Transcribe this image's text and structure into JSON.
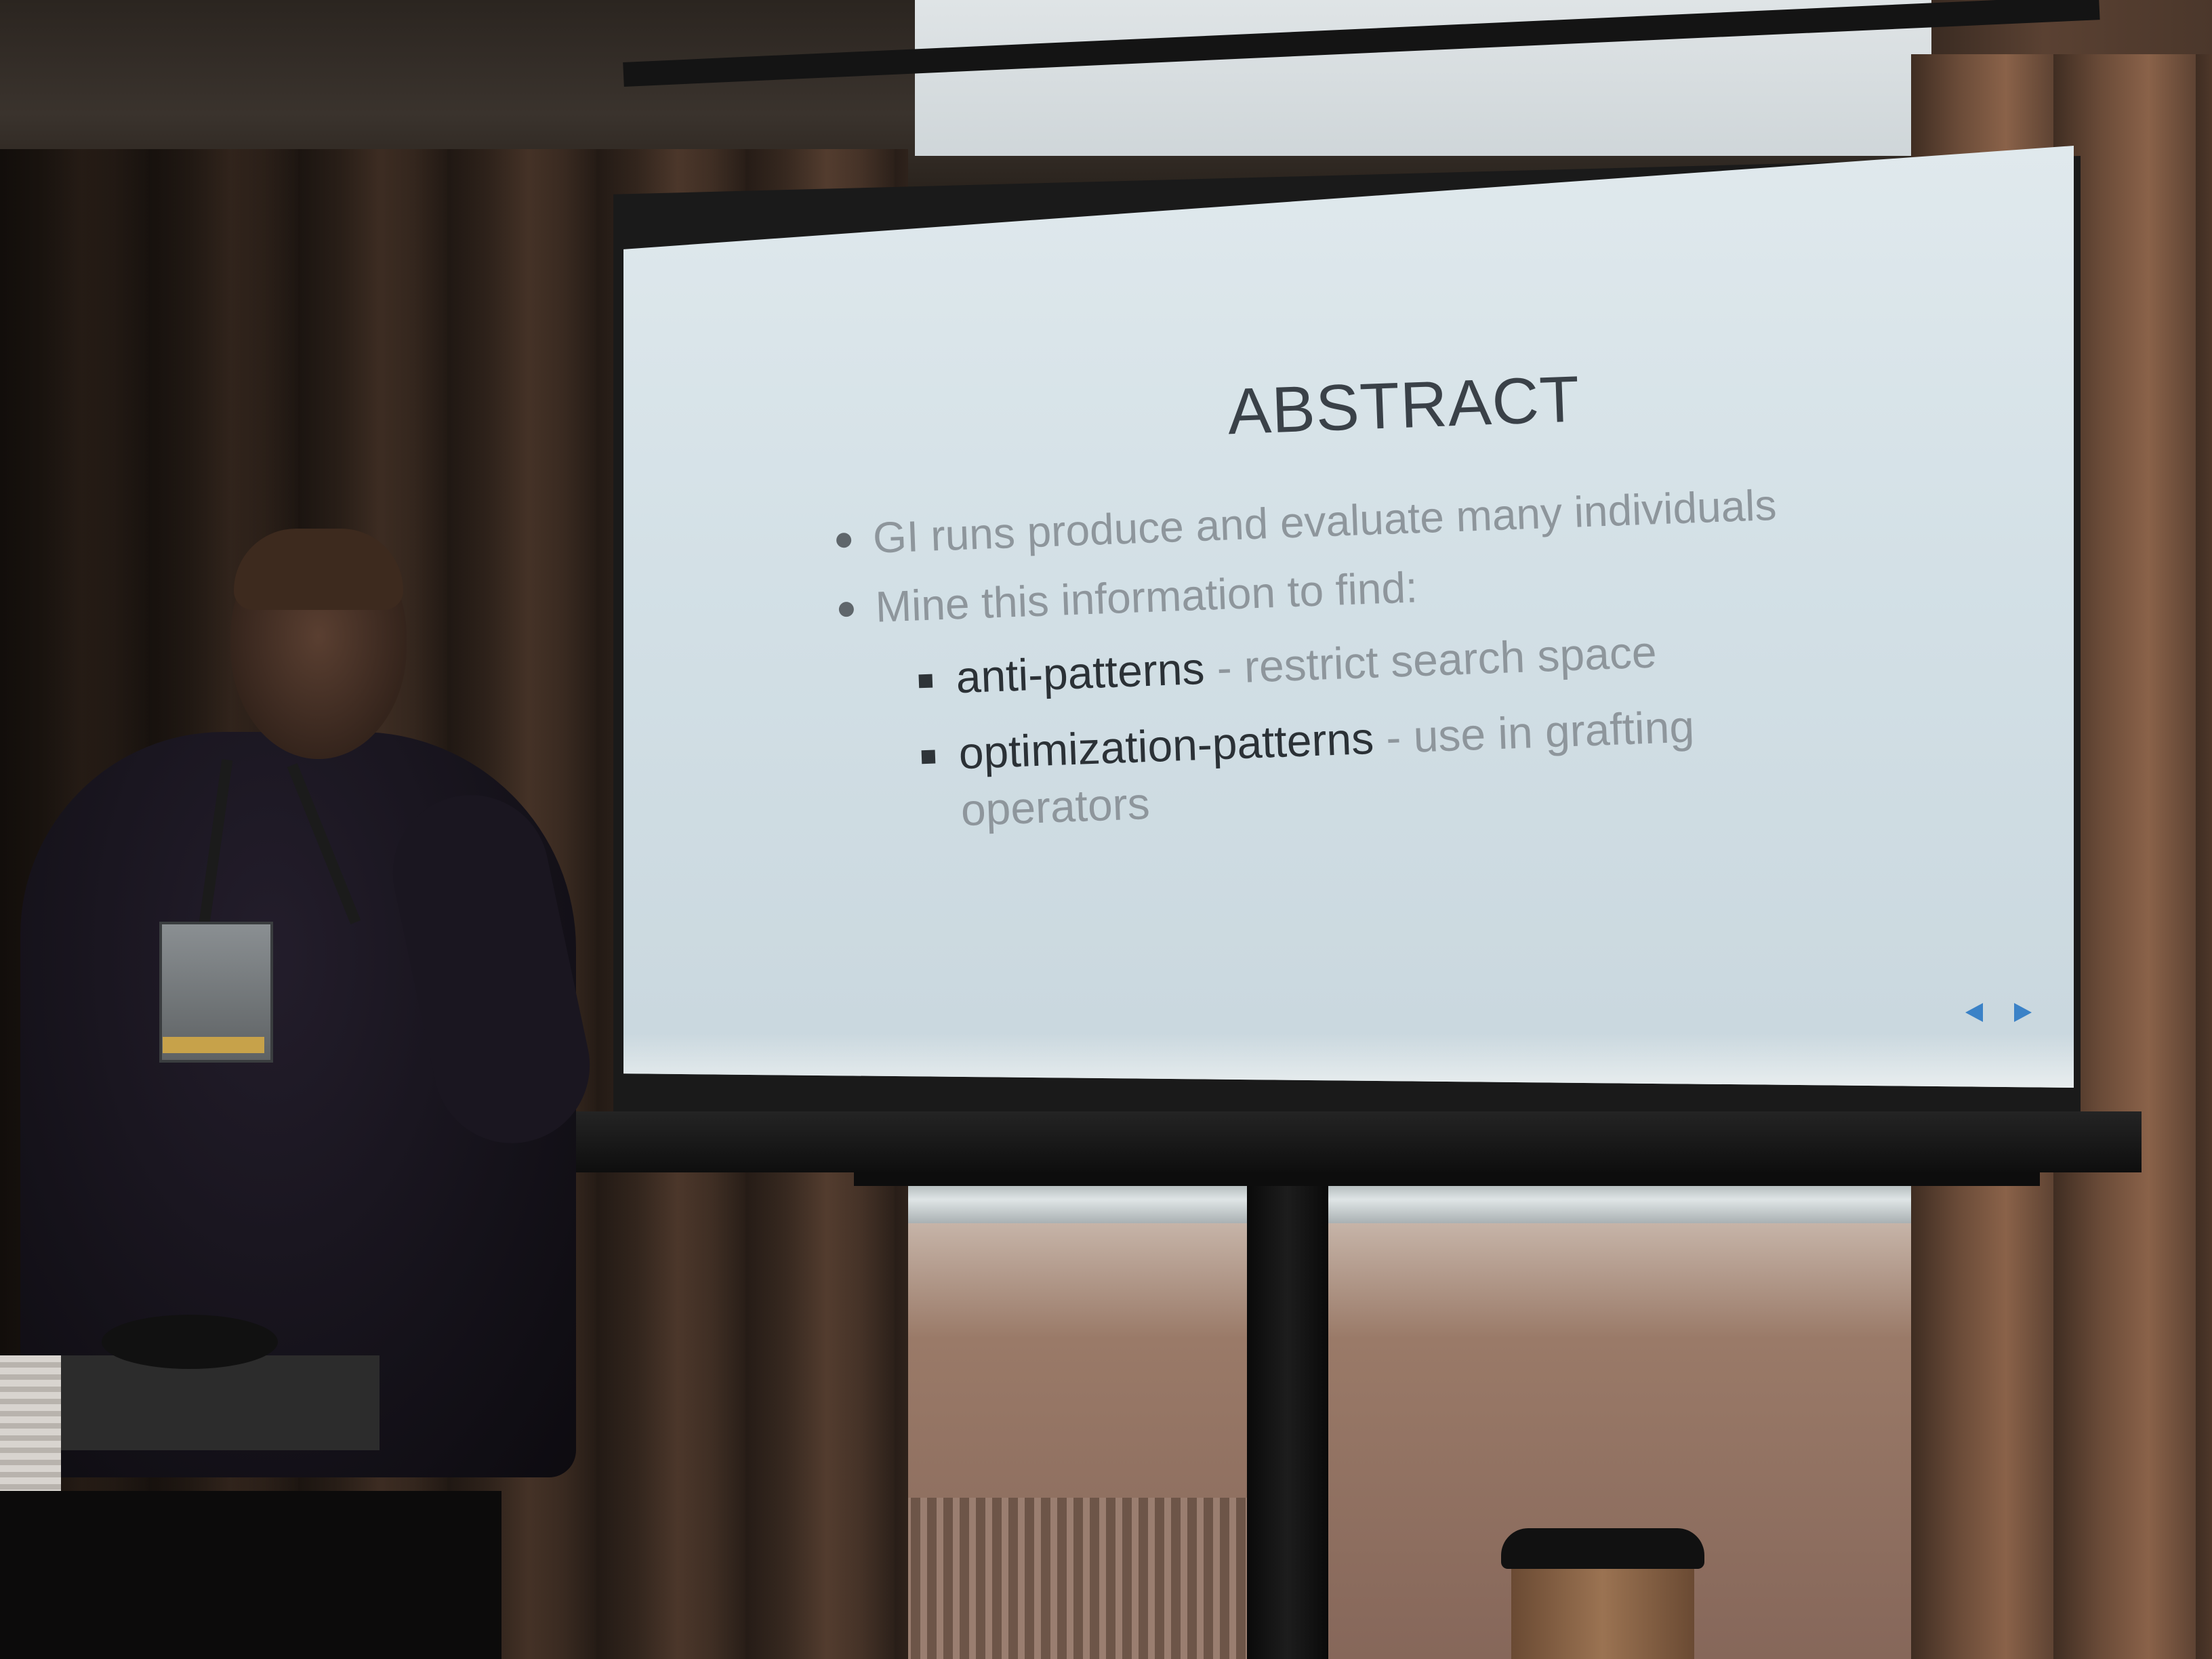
{
  "slide": {
    "title": "ABSTRACT",
    "bullets": [
      {
        "text": "GI runs produce and evaluate many individuals"
      },
      {
        "text": "Mine this information to find:"
      }
    ],
    "subbullets": [
      {
        "term": "anti-patterns",
        "desc": " - restrict search space",
        "desc_wrap": ""
      },
      {
        "term": "optimization-patterns",
        "desc": " - use in grafting",
        "desc_wrap": "operators"
      }
    ],
    "nav_icons": [
      "previous-arrow-icon",
      "next-arrow-icon"
    ]
  },
  "colors": {
    "slide_background": "#d3e0e6",
    "title_text": "#3a4148",
    "body_text": "#8e969c",
    "emphasis_text": "#2b3136",
    "nav_arrow": "#3b82c7"
  }
}
